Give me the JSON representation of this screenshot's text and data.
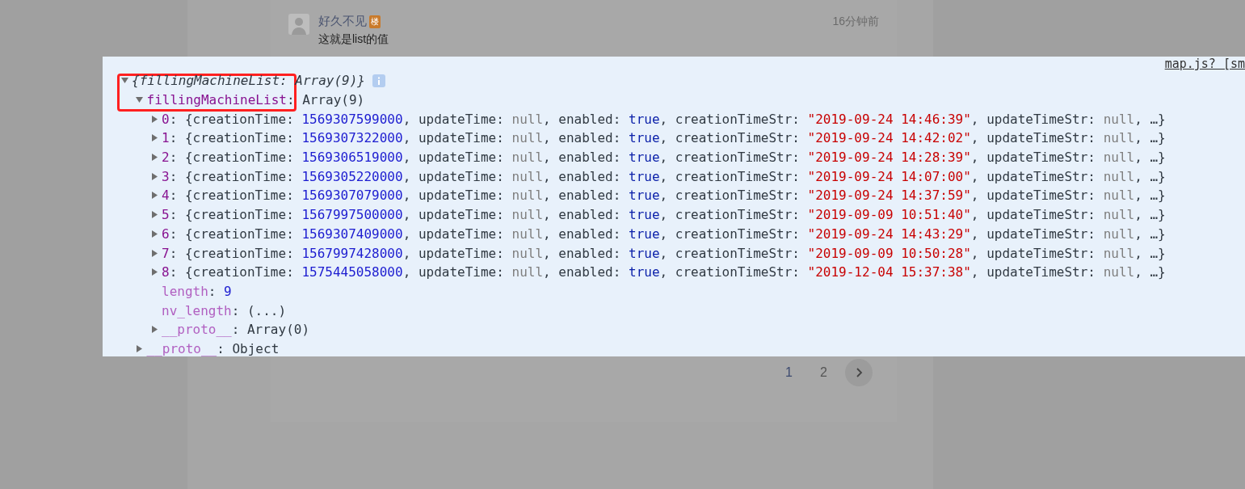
{
  "comment": {
    "author": "好久不见",
    "badge": "楼",
    "time": "16分钟前",
    "text": "这就是list的值"
  },
  "console": {
    "source_link": "map.js? [sm",
    "highlight": {
      "color": "#ff2020"
    },
    "root": {
      "tokens": [
        {
          "text": "{fillingMachineList: Array(9)}",
          "kind": "italic"
        }
      ],
      "expanded": true,
      "children": [
        {
          "tokens": [
            {
              "text": "fillingMachineList",
              "kind": "key"
            },
            {
              "text": ": Array(9)",
              "kind": "punct"
            }
          ],
          "expanded": true,
          "children": [
            {
              "expanded": false,
              "tokens": [
                {
                  "text": "0",
                  "kind": "key"
                },
                {
                  "text": ": {creationTime: ",
                  "kind": "punct"
                },
                {
                  "text": "1569307599000",
                  "kind": "number"
                },
                {
                  "text": ", updateTime: ",
                  "kind": "punct"
                },
                {
                  "text": "null",
                  "kind": "null"
                },
                {
                  "text": ", enabled: ",
                  "kind": "punct"
                },
                {
                  "text": "true",
                  "kind": "bool"
                },
                {
                  "text": ", creationTimeStr: ",
                  "kind": "punct"
                },
                {
                  "text": "\"2019-09-24 14:46:39\"",
                  "kind": "string"
                },
                {
                  "text": ", updateTimeStr: ",
                  "kind": "punct"
                },
                {
                  "text": "null",
                  "kind": "null"
                },
                {
                  "text": ", …}",
                  "kind": "punct"
                }
              ]
            },
            {
              "expanded": false,
              "tokens": [
                {
                  "text": "1",
                  "kind": "key"
                },
                {
                  "text": ": {creationTime: ",
                  "kind": "punct"
                },
                {
                  "text": "1569307322000",
                  "kind": "number"
                },
                {
                  "text": ", updateTime: ",
                  "kind": "punct"
                },
                {
                  "text": "null",
                  "kind": "null"
                },
                {
                  "text": ", enabled: ",
                  "kind": "punct"
                },
                {
                  "text": "true",
                  "kind": "bool"
                },
                {
                  "text": ", creationTimeStr: ",
                  "kind": "punct"
                },
                {
                  "text": "\"2019-09-24 14:42:02\"",
                  "kind": "string"
                },
                {
                  "text": ", updateTimeStr: ",
                  "kind": "punct"
                },
                {
                  "text": "null",
                  "kind": "null"
                },
                {
                  "text": ", …}",
                  "kind": "punct"
                }
              ]
            },
            {
              "expanded": false,
              "tokens": [
                {
                  "text": "2",
                  "kind": "key"
                },
                {
                  "text": ": {creationTime: ",
                  "kind": "punct"
                },
                {
                  "text": "1569306519000",
                  "kind": "number"
                },
                {
                  "text": ", updateTime: ",
                  "kind": "punct"
                },
                {
                  "text": "null",
                  "kind": "null"
                },
                {
                  "text": ", enabled: ",
                  "kind": "punct"
                },
                {
                  "text": "true",
                  "kind": "bool"
                },
                {
                  "text": ", creationTimeStr: ",
                  "kind": "punct"
                },
                {
                  "text": "\"2019-09-24 14:28:39\"",
                  "kind": "string"
                },
                {
                  "text": ", updateTimeStr: ",
                  "kind": "punct"
                },
                {
                  "text": "null",
                  "kind": "null"
                },
                {
                  "text": ", …}",
                  "kind": "punct"
                }
              ]
            },
            {
              "expanded": false,
              "tokens": [
                {
                  "text": "3",
                  "kind": "key"
                },
                {
                  "text": ": {creationTime: ",
                  "kind": "punct"
                },
                {
                  "text": "1569305220000",
                  "kind": "number"
                },
                {
                  "text": ", updateTime: ",
                  "kind": "punct"
                },
                {
                  "text": "null",
                  "kind": "null"
                },
                {
                  "text": ", enabled: ",
                  "kind": "punct"
                },
                {
                  "text": "true",
                  "kind": "bool"
                },
                {
                  "text": ", creationTimeStr: ",
                  "kind": "punct"
                },
                {
                  "text": "\"2019-09-24 14:07:00\"",
                  "kind": "string"
                },
                {
                  "text": ", updateTimeStr: ",
                  "kind": "punct"
                },
                {
                  "text": "null",
                  "kind": "null"
                },
                {
                  "text": ", …}",
                  "kind": "punct"
                }
              ]
            },
            {
              "expanded": false,
              "tokens": [
                {
                  "text": "4",
                  "kind": "key"
                },
                {
                  "text": ": {creationTime: ",
                  "kind": "punct"
                },
                {
                  "text": "1569307079000",
                  "kind": "number"
                },
                {
                  "text": ", updateTime: ",
                  "kind": "punct"
                },
                {
                  "text": "null",
                  "kind": "null"
                },
                {
                  "text": ", enabled: ",
                  "kind": "punct"
                },
                {
                  "text": "true",
                  "kind": "bool"
                },
                {
                  "text": ", creationTimeStr: ",
                  "kind": "punct"
                },
                {
                  "text": "\"2019-09-24 14:37:59\"",
                  "kind": "string"
                },
                {
                  "text": ", updateTimeStr: ",
                  "kind": "punct"
                },
                {
                  "text": "null",
                  "kind": "null"
                },
                {
                  "text": ", …}",
                  "kind": "punct"
                }
              ]
            },
            {
              "expanded": false,
              "tokens": [
                {
                  "text": "5",
                  "kind": "key"
                },
                {
                  "text": ": {creationTime: ",
                  "kind": "punct"
                },
                {
                  "text": "1567997500000",
                  "kind": "number"
                },
                {
                  "text": ", updateTime: ",
                  "kind": "punct"
                },
                {
                  "text": "null",
                  "kind": "null"
                },
                {
                  "text": ", enabled: ",
                  "kind": "punct"
                },
                {
                  "text": "true",
                  "kind": "bool"
                },
                {
                  "text": ", creationTimeStr: ",
                  "kind": "punct"
                },
                {
                  "text": "\"2019-09-09 10:51:40\"",
                  "kind": "string"
                },
                {
                  "text": ", updateTimeStr: ",
                  "kind": "punct"
                },
                {
                  "text": "null",
                  "kind": "null"
                },
                {
                  "text": ", …}",
                  "kind": "punct"
                }
              ]
            },
            {
              "expanded": false,
              "tokens": [
                {
                  "text": "6",
                  "kind": "key"
                },
                {
                  "text": ": {creationTime: ",
                  "kind": "punct"
                },
                {
                  "text": "1569307409000",
                  "kind": "number"
                },
                {
                  "text": ", updateTime: ",
                  "kind": "punct"
                },
                {
                  "text": "null",
                  "kind": "null"
                },
                {
                  "text": ", enabled: ",
                  "kind": "punct"
                },
                {
                  "text": "true",
                  "kind": "bool"
                },
                {
                  "text": ", creationTimeStr: ",
                  "kind": "punct"
                },
                {
                  "text": "\"2019-09-24 14:43:29\"",
                  "kind": "string"
                },
                {
                  "text": ", updateTimeStr: ",
                  "kind": "punct"
                },
                {
                  "text": "null",
                  "kind": "null"
                },
                {
                  "text": ", …}",
                  "kind": "punct"
                }
              ]
            },
            {
              "expanded": false,
              "tokens": [
                {
                  "text": "7",
                  "kind": "key"
                },
                {
                  "text": ": {creationTime: ",
                  "kind": "punct"
                },
                {
                  "text": "1567997428000",
                  "kind": "number"
                },
                {
                  "text": ", updateTime: ",
                  "kind": "punct"
                },
                {
                  "text": "null",
                  "kind": "null"
                },
                {
                  "text": ", enabled: ",
                  "kind": "punct"
                },
                {
                  "text": "true",
                  "kind": "bool"
                },
                {
                  "text": ", creationTimeStr: ",
                  "kind": "punct"
                },
                {
                  "text": "\"2019-09-09 10:50:28\"",
                  "kind": "string"
                },
                {
                  "text": ", updateTimeStr: ",
                  "kind": "punct"
                },
                {
                  "text": "null",
                  "kind": "null"
                },
                {
                  "text": ", …}",
                  "kind": "punct"
                }
              ]
            },
            {
              "expanded": false,
              "tokens": [
                {
                  "text": "8",
                  "kind": "key"
                },
                {
                  "text": ": {creationTime: ",
                  "kind": "punct"
                },
                {
                  "text": "1575445058000",
                  "kind": "number"
                },
                {
                  "text": ", updateTime: ",
                  "kind": "punct"
                },
                {
                  "text": "null",
                  "kind": "null"
                },
                {
                  "text": ", enabled: ",
                  "kind": "punct"
                },
                {
                  "text": "true",
                  "kind": "bool"
                },
                {
                  "text": ", creationTimeStr: ",
                  "kind": "punct"
                },
                {
                  "text": "\"2019-12-04 15:37:38\"",
                  "kind": "string"
                },
                {
                  "text": ", updateTimeStr: ",
                  "kind": "punct"
                },
                {
                  "text": "null",
                  "kind": "null"
                },
                {
                  "text": ", …}",
                  "kind": "punct"
                }
              ]
            },
            {
              "tokens": [
                {
                  "text": "length",
                  "kind": "inherent"
                },
                {
                  "text": ": ",
                  "kind": "punct"
                },
                {
                  "text": "9",
                  "kind": "number"
                }
              ]
            },
            {
              "tokens": [
                {
                  "text": "nv_length",
                  "kind": "inherent"
                },
                {
                  "text": ": (...)",
                  "kind": "punct"
                }
              ]
            },
            {
              "tokens": [
                {
                  "text": "__proto__",
                  "kind": "inherent"
                },
                {
                  "text": ": Array(0)",
                  "kind": "punct"
                }
              ],
              "expanded": false
            }
          ]
        },
        {
          "tokens": [
            {
              "text": "__proto__",
              "kind": "inherent"
            },
            {
              "text": ": Object",
              "kind": "punct"
            }
          ],
          "expanded": false
        }
      ]
    }
  },
  "pagination": {
    "pages": [
      {
        "label": "1",
        "selected": true
      },
      {
        "label": "2",
        "selected": false
      }
    ]
  }
}
